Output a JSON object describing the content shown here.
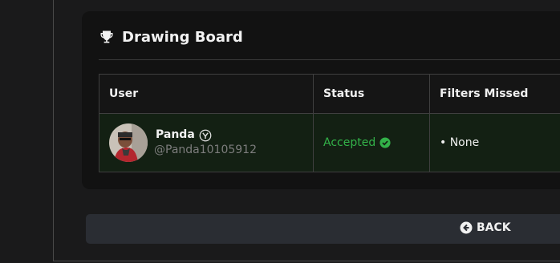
{
  "card": {
    "title": "Drawing Board",
    "icon": "trophy-icon"
  },
  "table": {
    "headers": [
      "User",
      "Status",
      "Filters Missed"
    ],
    "rows": [
      {
        "user_name": "Panda",
        "user_handle": "@Panda10105912",
        "status": "Accepted",
        "filters_missed": "• None"
      }
    ]
  },
  "back_button": {
    "label": "BACK",
    "icon": "arrow-left-circle-icon"
  },
  "colors": {
    "accepted": "#33b249",
    "row_bg": "#132013",
    "card_bg": "#121212",
    "button_bg": "#2a2d33"
  }
}
